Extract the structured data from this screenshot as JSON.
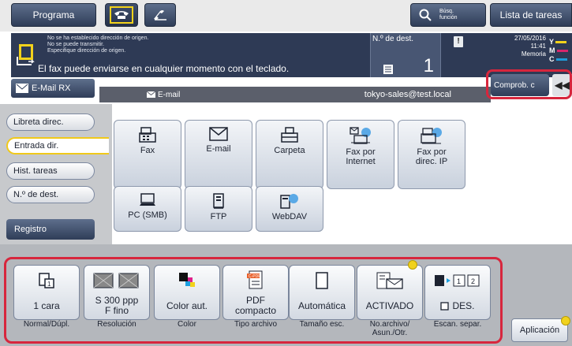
{
  "topbar": {
    "programa": "Programa",
    "busq": "Búsq.\nfunción",
    "lista_tareas": "Lista de tareas"
  },
  "status": {
    "messages": [
      "No se ha establecido dirección de origen.",
      "No se puede transmitir.",
      "Especifique dirección de origen."
    ],
    "main_message": "El fax puede enviarse en cualquier momento con el teclado.",
    "dest_label": "N.º de dest.",
    "dest_count": "1",
    "warning": "!",
    "date": "27/05/2016",
    "time": "11:41",
    "memory": "Memoria",
    "toner": [
      "Y",
      "M",
      "C"
    ],
    "toner_colors": [
      "#f3d21b",
      "#d7266b",
      "#1e9bd7"
    ]
  },
  "email_strip": {
    "emailrx": "E-Mail RX",
    "type": "E-mail",
    "address": "tokyo-sales@test.local",
    "comprob": "Comprob. c",
    "collapse": "◀◀"
  },
  "left_tabs": [
    "Libreta direc.",
    "Entrada dir.",
    "Hist. tareas",
    "N.º de dest."
  ],
  "registro": "Registro",
  "destinations": {
    "fax": "Fax",
    "email": "E-mail",
    "carpeta": "Carpeta",
    "fax_internet": "Fax por\nInternet",
    "fax_ip": "Fax por\ndirec. IP",
    "pc_smb": "PC (SMB)",
    "ftp": "FTP",
    "webdav": "WebDAV"
  },
  "options": [
    {
      "value": "1 cara",
      "caption": "Normal/Dúpl."
    },
    {
      "value": "S 300 ppp\nF fino",
      "caption": "Resolución"
    },
    {
      "value": "Color aut.",
      "caption": "Color"
    },
    {
      "value": "PDF\ncompacto",
      "caption": "Tipo archivo"
    },
    {
      "value": "Automática",
      "caption": "Tamaño esc."
    },
    {
      "value": "ACTIVADO",
      "caption": "No.archivo/\nAsun./Otr."
    },
    {
      "value": "DES.",
      "caption": "Escan. separ."
    }
  ],
  "aplicacion": "Aplicación",
  "colors": {
    "dark_panel": "#2e3a55",
    "highlight": "#d7263d",
    "accent_yellow": "#f1d21d"
  }
}
